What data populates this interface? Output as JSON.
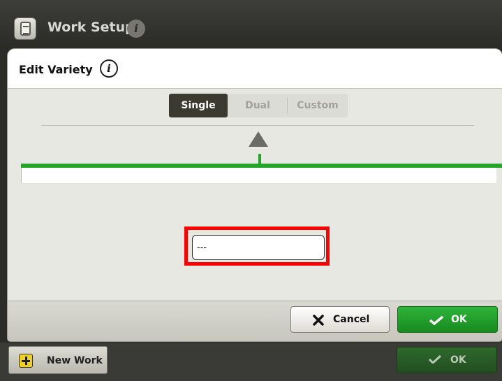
{
  "background": {
    "header": {
      "title": "Work Setup"
    },
    "footer": {
      "new_work_label": "New Work",
      "ok_label": "OK"
    }
  },
  "dialog": {
    "title": "Edit Variety",
    "mode_tabs": [
      {
        "label": "Single",
        "active": true
      },
      {
        "label": "Dual",
        "active": false
      },
      {
        "label": "Custom",
        "active": false
      }
    ],
    "variety_field": {
      "value": "---"
    },
    "buttons": {
      "cancel": "Cancel",
      "ok": "OK"
    }
  },
  "colors": {
    "accent_green": "#23a52a",
    "highlight_red": "#ff0000",
    "active_tab": "#3a3a31"
  },
  "icons": [
    "work-setup-app-icon",
    "info-icon",
    "arrow-up-icon",
    "plus-icon",
    "close-x-icon",
    "checkmark-icon"
  ]
}
